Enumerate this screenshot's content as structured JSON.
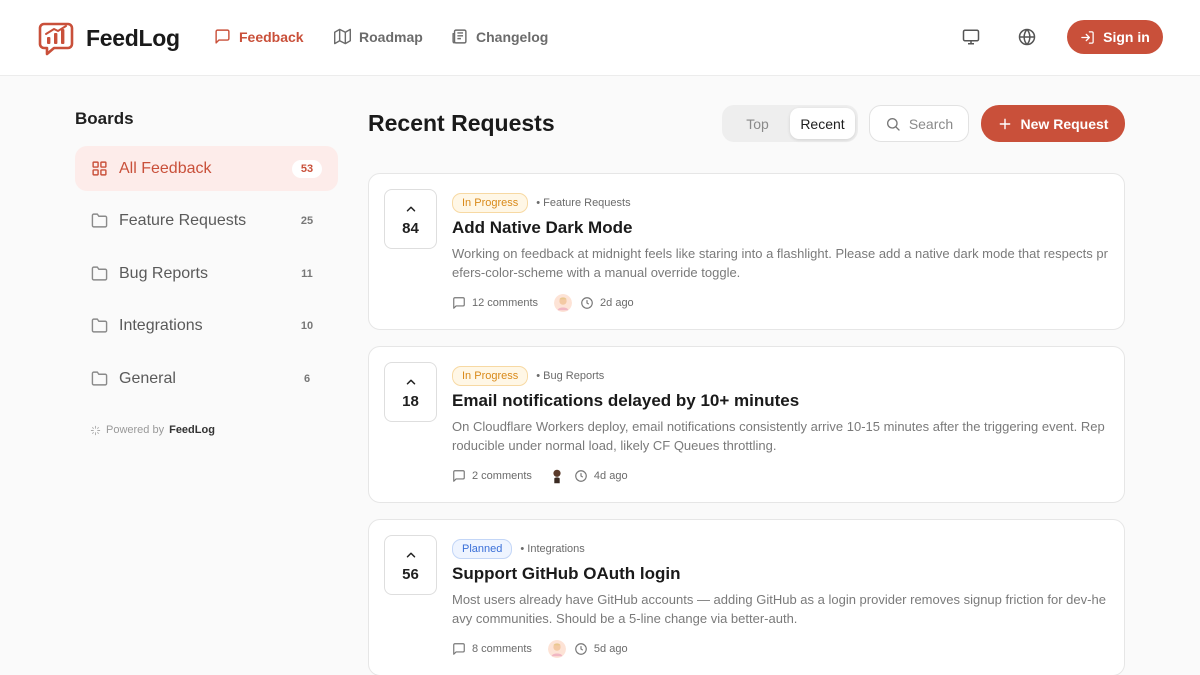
{
  "app": {
    "name": "FeedLog",
    "nav": [
      {
        "label": "Feedback",
        "icon": "message-square-icon",
        "active": true
      },
      {
        "label": "Roadmap",
        "icon": "map-icon",
        "active": false
      },
      {
        "label": "Changelog",
        "icon": "newspaper-icon",
        "active": false
      }
    ],
    "signin_label": "Sign in"
  },
  "sidebar": {
    "title": "Boards",
    "items": [
      {
        "label": "All Feedback",
        "count": "53",
        "icon": "grid-icon",
        "active": true
      },
      {
        "label": "Feature Requests",
        "count": "25",
        "icon": "folder-icon",
        "active": false
      },
      {
        "label": "Bug Reports",
        "count": "11",
        "icon": "folder-icon",
        "active": false
      },
      {
        "label": "Integrations",
        "count": "10",
        "icon": "folder-icon",
        "active": false
      },
      {
        "label": "General",
        "count": "6",
        "icon": "folder-icon",
        "active": false
      }
    ],
    "powered_prefix": "Powered by",
    "powered_brand": "FeedLog"
  },
  "main": {
    "title": "Recent Requests",
    "sort_tabs": [
      {
        "label": "Top",
        "active": false
      },
      {
        "label": "Recent",
        "active": true
      }
    ],
    "search_label": "Search",
    "new_request_label": "New Request"
  },
  "requests": [
    {
      "votes": "84",
      "status": "In Progress",
      "board": "• Feature Requests",
      "title": "Add Native Dark Mode",
      "description": "Working on feedback at midnight feels like staring into a flashlight. Please add a native dark mode that respects prefers-color-scheme with a manual override toggle.",
      "comments": "12 comments",
      "time": "2d ago"
    },
    {
      "votes": "18",
      "status": "In Progress",
      "board": "• Bug Reports",
      "title": "Email notifications delayed by 10+ minutes",
      "description": "On Cloudflare Workers deploy, email notifications consistently arrive 10-15 minutes after the triggering event. Reproducible under normal load, likely CF Queues throttling.",
      "comments": "2 comments",
      "time": "4d ago"
    },
    {
      "votes": "56",
      "status": "Planned",
      "board": "• Integrations",
      "title": "Support GitHub OAuth login",
      "description": "Most users already have GitHub accounts — adding GitHub as a login provider removes signup friction for dev-heavy communities. Should be a 5-line change via better-auth.",
      "comments": "8 comments",
      "time": "5d ago"
    }
  ],
  "colors": {
    "accent": "#c9503a",
    "accent_soft": "#fdecea",
    "status_in_progress": "#d98a1a",
    "status_planned": "#3a6fd8"
  }
}
